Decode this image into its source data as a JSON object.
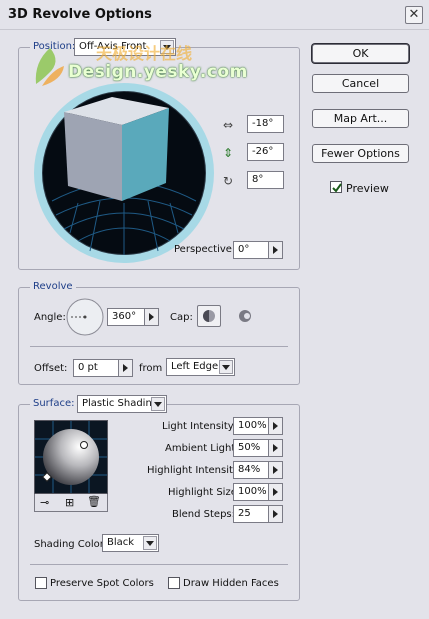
{
  "window": {
    "title": "3D Revolve Options"
  },
  "buttons": {
    "ok": "OK",
    "cancel": "Cancel",
    "map_art": "Map Art...",
    "fewer_options": "Fewer Options"
  },
  "preview": {
    "label": "Preview",
    "checked": true
  },
  "position": {
    "label": "Position:",
    "value": "Off-Axis Front"
  },
  "rotation": {
    "x": "-18°",
    "y": "-26°",
    "z": "8°"
  },
  "perspective": {
    "label": "Perspective:",
    "value": "0°"
  },
  "revolve": {
    "group_label": "Revolve",
    "angle_label": "Angle:",
    "angle_value": "360°",
    "cap_label": "Cap:",
    "offset_label": "Offset:",
    "offset_value": "0 pt",
    "from_label": "from",
    "from_value": "Left Edge"
  },
  "surface": {
    "label": "Surface:",
    "value": "Plastic Shading",
    "light_intensity": {
      "label": "Light Intensity:",
      "value": "100%"
    },
    "ambient_light": {
      "label": "Ambient Light:",
      "value": "50%"
    },
    "highlight_intensity": {
      "label": "Highlight Intensity:",
      "value": "84%"
    },
    "highlight_size": {
      "label": "Highlight Size:",
      "value": "100%"
    },
    "blend_steps": {
      "label": "Blend Steps:",
      "value": "25"
    },
    "shading_color_label": "Shading Color:",
    "shading_color_value": "Black",
    "preserve_spot_label": "Preserve Spot Colors",
    "draw_hidden_label": "Draw Hidden Faces"
  },
  "watermark": {
    "cn": "天极设计在线",
    "en": "Design.yesky.com"
  },
  "colors": {
    "accent": "#1e3e88",
    "cube_front": "#5aa9bb",
    "track_ring": "#a7d9e6"
  }
}
